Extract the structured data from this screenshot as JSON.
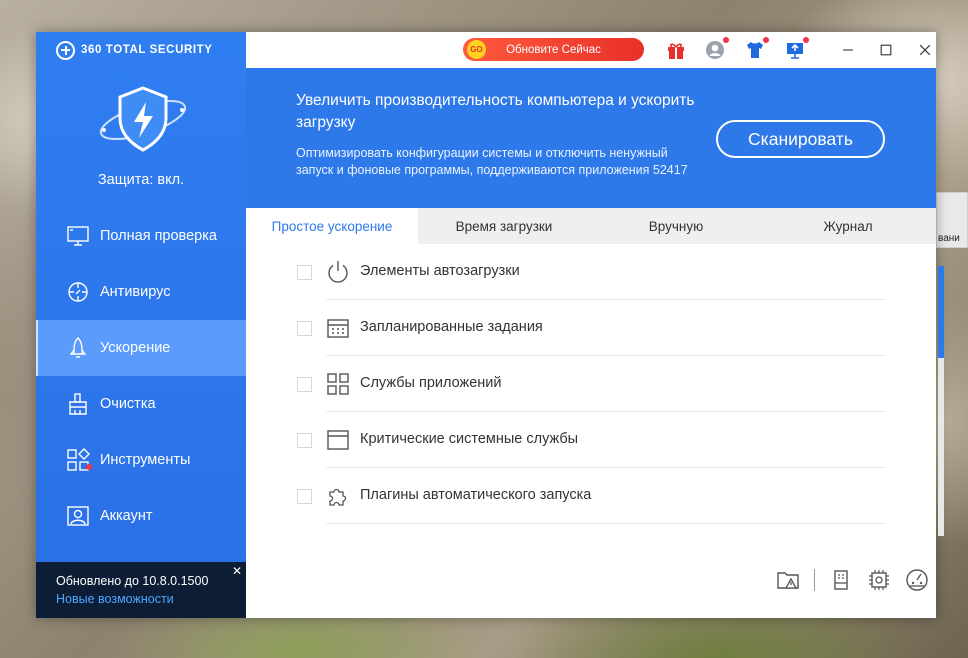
{
  "app": {
    "brand": "360 TOTAL SECURITY",
    "protection_status": "Защита: вкл.",
    "accent": "#2d79ea"
  },
  "sidebar": {
    "items": [
      {
        "label": "Полная проверка",
        "icon": "monitor-icon"
      },
      {
        "label": "Антивирус",
        "icon": "crosshair-icon"
      },
      {
        "label": "Ускорение",
        "icon": "rocket-icon"
      },
      {
        "label": "Очистка",
        "icon": "brush-icon"
      },
      {
        "label": "Инструменты",
        "icon": "tools-grid-icon"
      },
      {
        "label": "Аккаунт",
        "icon": "user-icon"
      }
    ],
    "update": {
      "title": "Обновлено до 10.8.0.1500",
      "link": "Новые возможности",
      "close": "✕"
    }
  },
  "titlebar": {
    "upgrade_label": "Обновите Сейчас",
    "upgrade_badge": "GO",
    "minimize": "—",
    "maximize": "☐",
    "close": "✕"
  },
  "banner": {
    "title": "Увеличить производительность компьютера и ускорить загрузку",
    "description": "Оптимизировать конфигурации системы и отключить ненужный запуск и фоновые программы, поддерживаются приложения 52417",
    "scan_label": "Сканировать"
  },
  "tabs": [
    {
      "label": "Простое ускорение"
    },
    {
      "label": "Время загрузки"
    },
    {
      "label": "Вручную"
    },
    {
      "label": "Журнал"
    }
  ],
  "list": [
    {
      "label": "Элементы автозагрузки",
      "icon": "power-icon"
    },
    {
      "label": "Запланированные задания",
      "icon": "calendar-icon"
    },
    {
      "label": "Службы приложений",
      "icon": "apps-grid-icon"
    },
    {
      "label": "Критические системные службы",
      "icon": "window-icon"
    },
    {
      "label": "Плагины автоматического запуска",
      "icon": "puzzle-icon"
    }
  ],
  "desktop": {
    "thumb_text": "вани"
  }
}
